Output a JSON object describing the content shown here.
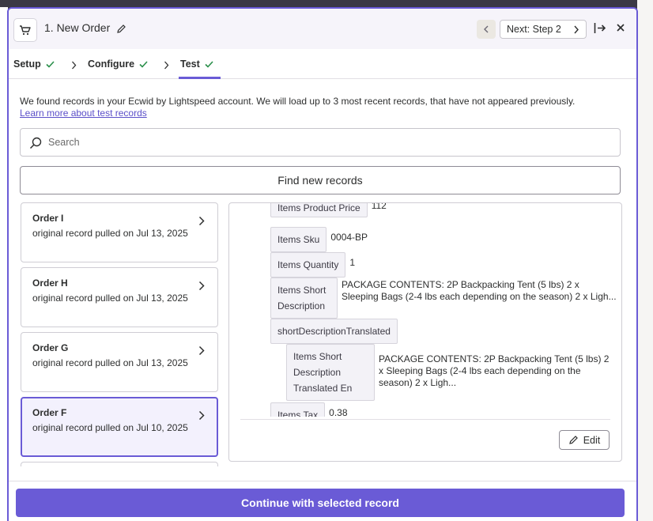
{
  "header": {
    "title": "1. New Order",
    "next_label": "Next: Step 2"
  },
  "tabs": [
    {
      "label": "Setup"
    },
    {
      "label": "Configure"
    },
    {
      "label": "Test"
    }
  ],
  "intro": {
    "text": "We found records in your Ecwid by Lightspeed account. We will load up to 3 most recent records, that have not appeared previously.",
    "link": "Learn more about test records"
  },
  "search": {
    "placeholder": "Search"
  },
  "find_button": "Find new records",
  "records": [
    {
      "name": "Order I",
      "desc": "original record pulled on Jul 13, 2025"
    },
    {
      "name": "Order H",
      "desc": "original record pulled on Jul 13, 2025"
    },
    {
      "name": "Order G",
      "desc": "original record pulled on Jul 13, 2025"
    },
    {
      "name": "Order F",
      "desc": "original record pulled on Jul 10, 2025"
    }
  ],
  "details": [
    {
      "key": "Items Product Price",
      "value": "112"
    },
    {
      "key": "Items Sku",
      "value": "0004-BP"
    },
    {
      "key": "Items Quantity",
      "value": "1"
    },
    {
      "key": "Items Short Description",
      "value": "PACKAGE CONTENTS: 2P Backpacking Tent (5 lbs) 2 x Sleeping Bags (2-4 lbs each depending on the season) 2 x Ligh..."
    },
    {
      "key": "shortDescriptionTranslated",
      "value": ""
    },
    {
      "key": "Items Short Description Translated En",
      "value": "PACKAGE CONTENTS: 2P Backpacking Tent (5 lbs) 2 x Sleeping Bags (2-4 lbs each depending on the season) 2 x Ligh..."
    },
    {
      "key": "Items Tax",
      "value": "0.38"
    }
  ],
  "edit_label": "Edit",
  "continue_label": "Continue with selected record",
  "colors": {
    "accent": "#6a5bd6",
    "success": "#2a8f4a"
  }
}
